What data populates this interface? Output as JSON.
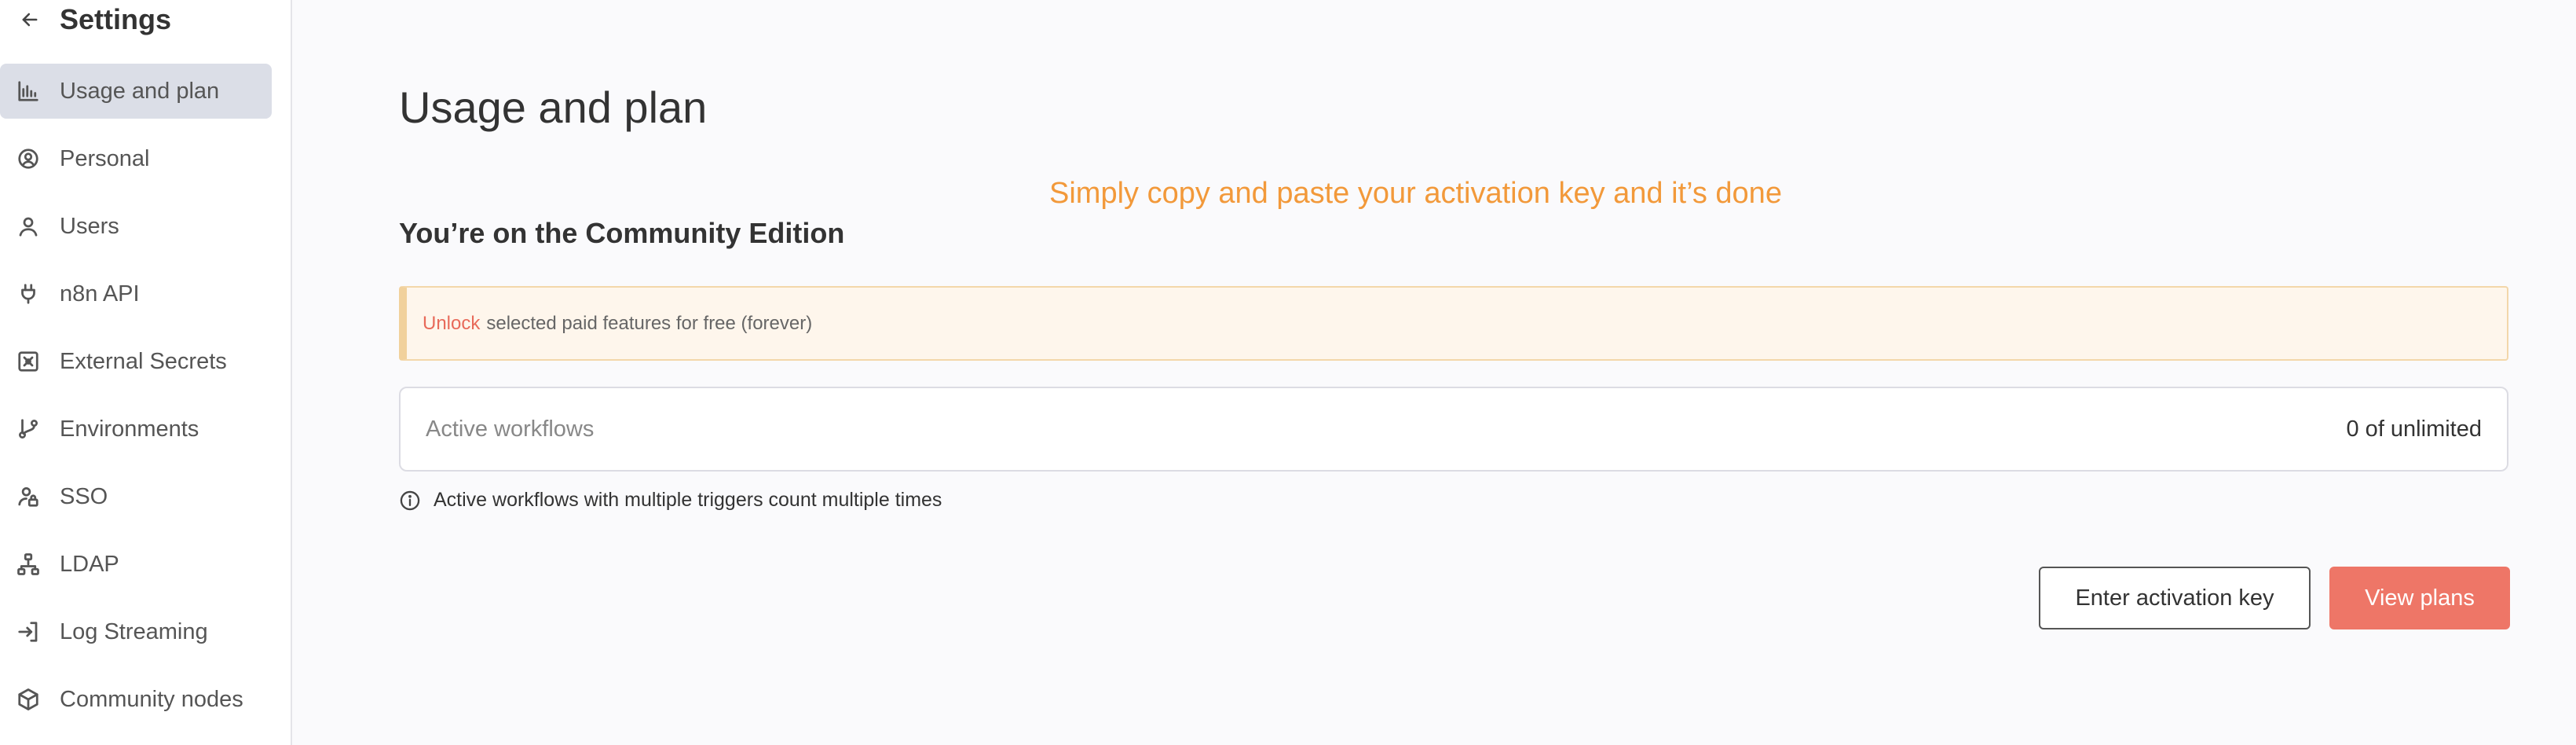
{
  "sidebar": {
    "title": "Settings",
    "back_icon": "arrow-left-icon",
    "items": [
      {
        "label": "Usage and plan",
        "icon": "bar-chart-icon",
        "active": true
      },
      {
        "label": "Personal",
        "icon": "user-circle-icon",
        "active": false
      },
      {
        "label": "Users",
        "icon": "user-icon",
        "active": false
      },
      {
        "label": "n8n API",
        "icon": "plug-icon",
        "active": false
      },
      {
        "label": "External Secrets",
        "icon": "vault-icon",
        "active": false
      },
      {
        "label": "Environments",
        "icon": "git-branch-icon",
        "active": false
      },
      {
        "label": "SSO",
        "icon": "user-lock-icon",
        "active": false
      },
      {
        "label": "LDAP",
        "icon": "network-icon",
        "active": false
      },
      {
        "label": "Log Streaming",
        "icon": "sign-in-icon",
        "active": false
      },
      {
        "label": "Community nodes",
        "icon": "cube-icon",
        "active": false
      }
    ]
  },
  "main": {
    "title": "Usage and plan",
    "callout": "Simply copy and paste your activation key and it’s done",
    "edition": "You’re on the Community Edition",
    "banner": {
      "link": "Unlock",
      "text": "selected paid features for free (forever)"
    },
    "workflows": {
      "label": "Active workflows",
      "value": "0 of unlimited"
    },
    "info_text": "Active workflows with multiple triggers count multiple times",
    "buttons": {
      "activation": "Enter activation key",
      "plans": "View plans"
    }
  },
  "colors": {
    "primary": "#ee7667",
    "callout": "#f2993a",
    "active_nav": "#dbdee7",
    "banner_bg": "#fef6ec"
  }
}
